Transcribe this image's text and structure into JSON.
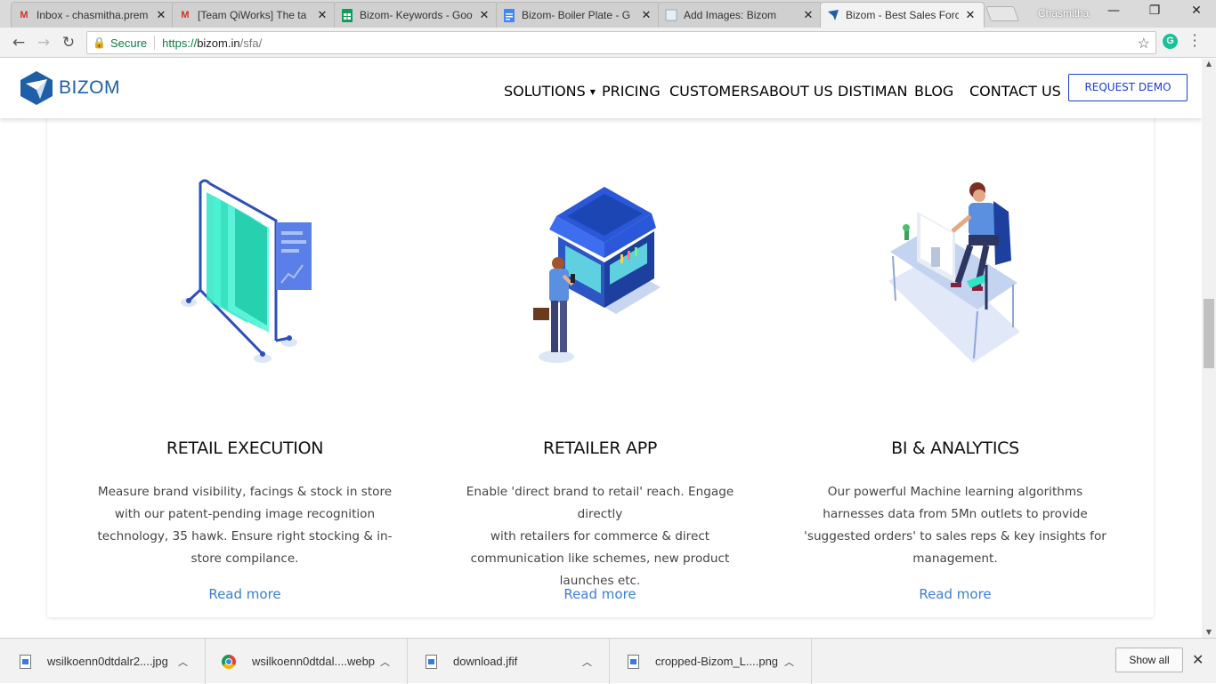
{
  "browser": {
    "tabs": [
      {
        "title": "Inbox - chasmitha.prem",
        "favicon": "gmail-icon"
      },
      {
        "title": "[Team QiWorks] The ta",
        "favicon": "gmail-icon"
      },
      {
        "title": "Bizom- Keywords - Goo",
        "favicon": "sheets-icon"
      },
      {
        "title": "Bizom- Boiler Plate - G",
        "favicon": "docs-icon"
      },
      {
        "title": "Add Images: Bizom",
        "favicon": "blank-page-icon"
      },
      {
        "title": "Bizom - Best Sales Forc",
        "favicon": "bizom-icon",
        "active": true
      }
    ],
    "profile_name": "Chasmitha",
    "secure_label": "Secure",
    "url_scheme": "https://",
    "url_host": "bizom.in",
    "url_path": "/sfa/"
  },
  "site": {
    "logo_text": "BIZOM",
    "nav": [
      "SOLUTIONS",
      "PRICING",
      "CUSTOMERS",
      "ABOUT US",
      "DISTIMAN",
      "BLOG",
      "CONTACT US"
    ],
    "cta": "REQUEST DEMO"
  },
  "features": [
    {
      "title": "RETAIL EXECUTION",
      "desc_lines": [
        "Measure brand visibility, facings & stock in store",
        "with our patent-pending image recognition",
        "technology, 35 hawk. Ensure right stocking & in-",
        "store compilance."
      ],
      "link": "Read more"
    },
    {
      "title": "RETAILER APP",
      "desc_lines": [
        "Enable 'direct brand to retail' reach. Engage directly",
        "with retailers for commerce & direct",
        "communication like schemes, new product",
        "launches etc."
      ],
      "link": "Read more"
    },
    {
      "title": "BI & ANALYTICS",
      "desc_lines": [
        "Our powerful Machine learning algorithms",
        "harnesses data from 5Mn outlets to provide",
        "'suggested orders' to sales reps & key insights for",
        "management."
      ],
      "link": "Read more"
    }
  ],
  "downloads": {
    "items": [
      "wsilkoenn0dtdalr2....jpg",
      "wsilkoenn0dtdal....webp",
      "download.jfif",
      "cropped-Bizom_L....png"
    ],
    "show_all": "Show all"
  },
  "colors": {
    "brand_blue": "#1e5fa8",
    "cta_blue": "#1a3ed4",
    "link_blue": "#3a7fd5",
    "secure_green": "#0b8043"
  }
}
